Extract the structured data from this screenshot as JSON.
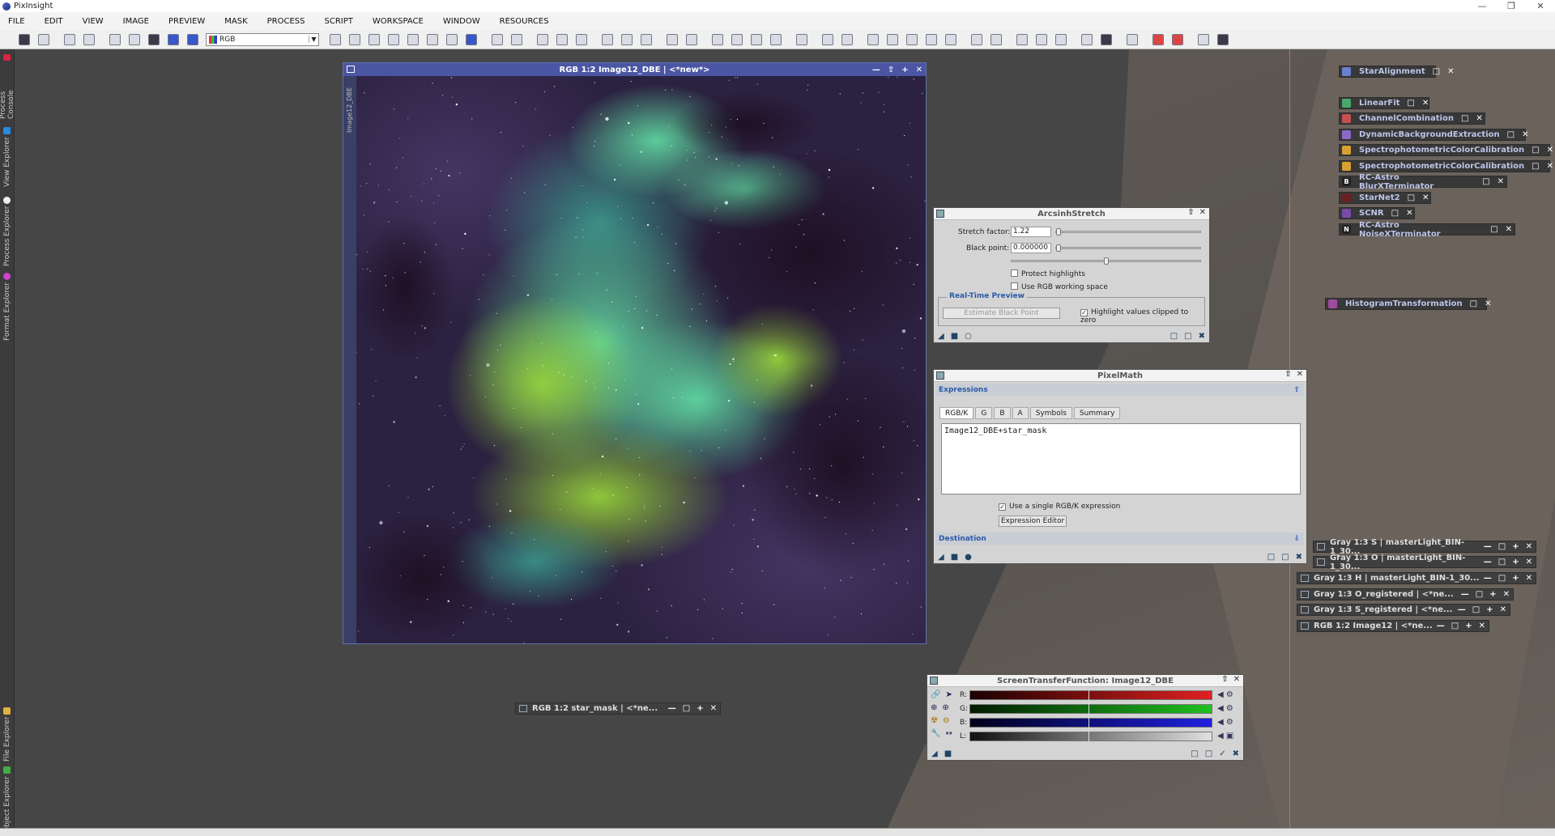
{
  "app": {
    "title": "PixInsight"
  },
  "menu": [
    "FILE",
    "EDIT",
    "VIEW",
    "IMAGE",
    "PREVIEW",
    "MASK",
    "PROCESS",
    "SCRIPT",
    "WORKSPACE",
    "WINDOW",
    "RESOURCES"
  ],
  "toolbar": {
    "colorspace": "RGB"
  },
  "left_tabs": [
    "Process Console",
    "View Explorer",
    "Process Explorer",
    "Format Explorer",
    "File Explorer",
    "Object Explorer"
  ],
  "image_window": {
    "title": "RGB 1:2 Image12_DBE | <*new*>",
    "side_label": "Image12_DBE"
  },
  "star_mask_window": {
    "title": "RGB 1:2 star_mask | <*ne..."
  },
  "process_icons": [
    {
      "label": "StarAlignment",
      "color": "#6a7fd0"
    },
    {
      "label": "LinearFit",
      "color": "#4aa86a"
    },
    {
      "label": "ChannelCombination",
      "color": "#c85050"
    },
    {
      "label": "DynamicBackgroundExtraction",
      "color": "#8a6ac8"
    },
    {
      "label": "SpectrophotometricColorCalibration",
      "color": "#d8a030"
    },
    {
      "label": "SpectrophotometricColorCalibration",
      "color": "#d8a030"
    },
    {
      "label": "RC-Astro BlurXTerminator",
      "color": "#222222"
    },
    {
      "label": "StarNet2",
      "color": "#6a2020"
    },
    {
      "label": "SCNR",
      "color": "#7a4aa8"
    },
    {
      "label": "RC-Astro NoiseXTerminator",
      "color": "#222222"
    }
  ],
  "histogram_icon": {
    "label": "HistogramTransformation"
  },
  "arcsinh": {
    "title": "ArcsinhStretch",
    "stretch_label": "Stretch factor:",
    "stretch_value": "1.22",
    "black_label": "Black point:",
    "black_value": "0.000000",
    "protect": "Protect highlights",
    "use_rgb": "Use RGB working space",
    "preview_section": "Real-Time Preview",
    "estimate_btn": "Estimate Black Point",
    "highlight": "Highlight values clipped to zero"
  },
  "pixelmath": {
    "title": "PixelMath",
    "section": "Expressions",
    "tabs": [
      "RGB/K",
      "G",
      "B",
      "A",
      "Symbols",
      "Summary"
    ],
    "expression": "Image12_DBE+star_mask",
    "single": "Use a single RGB/K expression",
    "editor_btn": "Expression Editor",
    "destination": "Destination"
  },
  "minimized": [
    "Gray 1:3 S | masterLight_BIN-1_30...",
    "Gray 1:3 O | masterLight_BIN-1_30...",
    "Gray 1:3 H | masterLight_BIN-1_30...",
    "Gray 1:3 O_registered | <*ne...",
    "Gray 1:3 S_registered | <*ne...",
    "RGB 1:2 Image12 | <*ne..."
  ],
  "stf": {
    "title": "ScreenTransferFunction: Image12_DBE",
    "channels": [
      {
        "label": "R:",
        "color": "#e02020"
      },
      {
        "label": "G:",
        "color": "#20c020"
      },
      {
        "label": "B:",
        "color": "#2020e0"
      },
      {
        "label": "L:",
        "color": "#e0e0e0"
      }
    ]
  }
}
